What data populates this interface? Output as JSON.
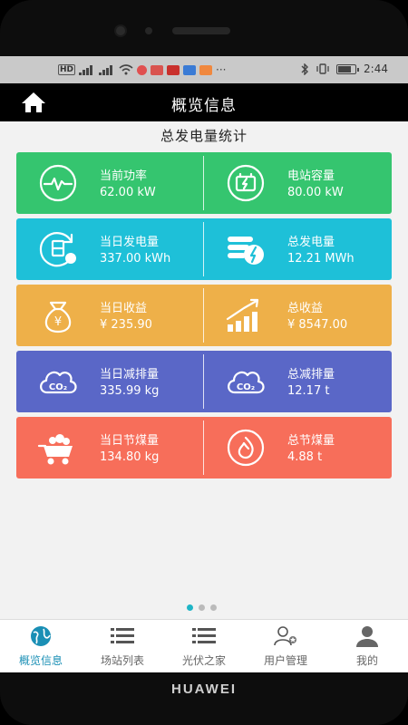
{
  "status_bar": {
    "left_text": "HD",
    "time": "2:44"
  },
  "app": {
    "title": "概览信息"
  },
  "section": {
    "title": "总发电量统计"
  },
  "stats": [
    {
      "color": "#35c56f",
      "left": {
        "icon": "pulse-icon",
        "label": "当前功率",
        "value": "62.00 kW"
      },
      "right": {
        "icon": "battery-icon",
        "label": "电站容量",
        "value": "80.00 kW"
      }
    },
    {
      "color": "#1ec0d8",
      "left": {
        "icon": "daily-energy-icon",
        "label": "当日发电量",
        "value": "337.00 kWh"
      },
      "right": {
        "icon": "total-energy-icon",
        "label": "总发电量",
        "value": "12.21 MWh"
      }
    },
    {
      "color": "#eeb049",
      "left": {
        "icon": "money-bag-icon",
        "label": "当日收益",
        "value": "¥ 235.90"
      },
      "right": {
        "icon": "growth-chart-icon",
        "label": "总收益",
        "value": "¥ 8547.00"
      }
    },
    {
      "color": "#5a67c7",
      "left": {
        "icon": "co2-cloud-icon",
        "label": "当日减排量",
        "value": "335.99 kg"
      },
      "right": {
        "icon": "co2-cloud-icon",
        "label": "总减排量",
        "value": "12.17 t"
      }
    },
    {
      "color": "#f76e5a",
      "left": {
        "icon": "coal-cart-icon",
        "label": "当日节煤量",
        "value": "134.80 kg"
      },
      "right": {
        "icon": "flame-icon",
        "label": "总节煤量",
        "value": "4.88 t"
      }
    }
  ],
  "pager": {
    "count": 3,
    "active": 0
  },
  "tabs": [
    {
      "icon": "globe-icon",
      "label": "概览信息",
      "active": true
    },
    {
      "icon": "list-icon",
      "label": "场站列表",
      "active": false
    },
    {
      "icon": "list-icon",
      "label": "光伏之家",
      "active": false
    },
    {
      "icon": "users-icon",
      "label": "用户管理",
      "active": false
    },
    {
      "icon": "person-icon",
      "label": "我的",
      "active": false
    }
  ],
  "device": {
    "brand": "HUAWEI"
  },
  "colors": {
    "active_tab": "#1a8fb5",
    "pager_active": "#1fb5c6",
    "appbar": "#000000"
  }
}
